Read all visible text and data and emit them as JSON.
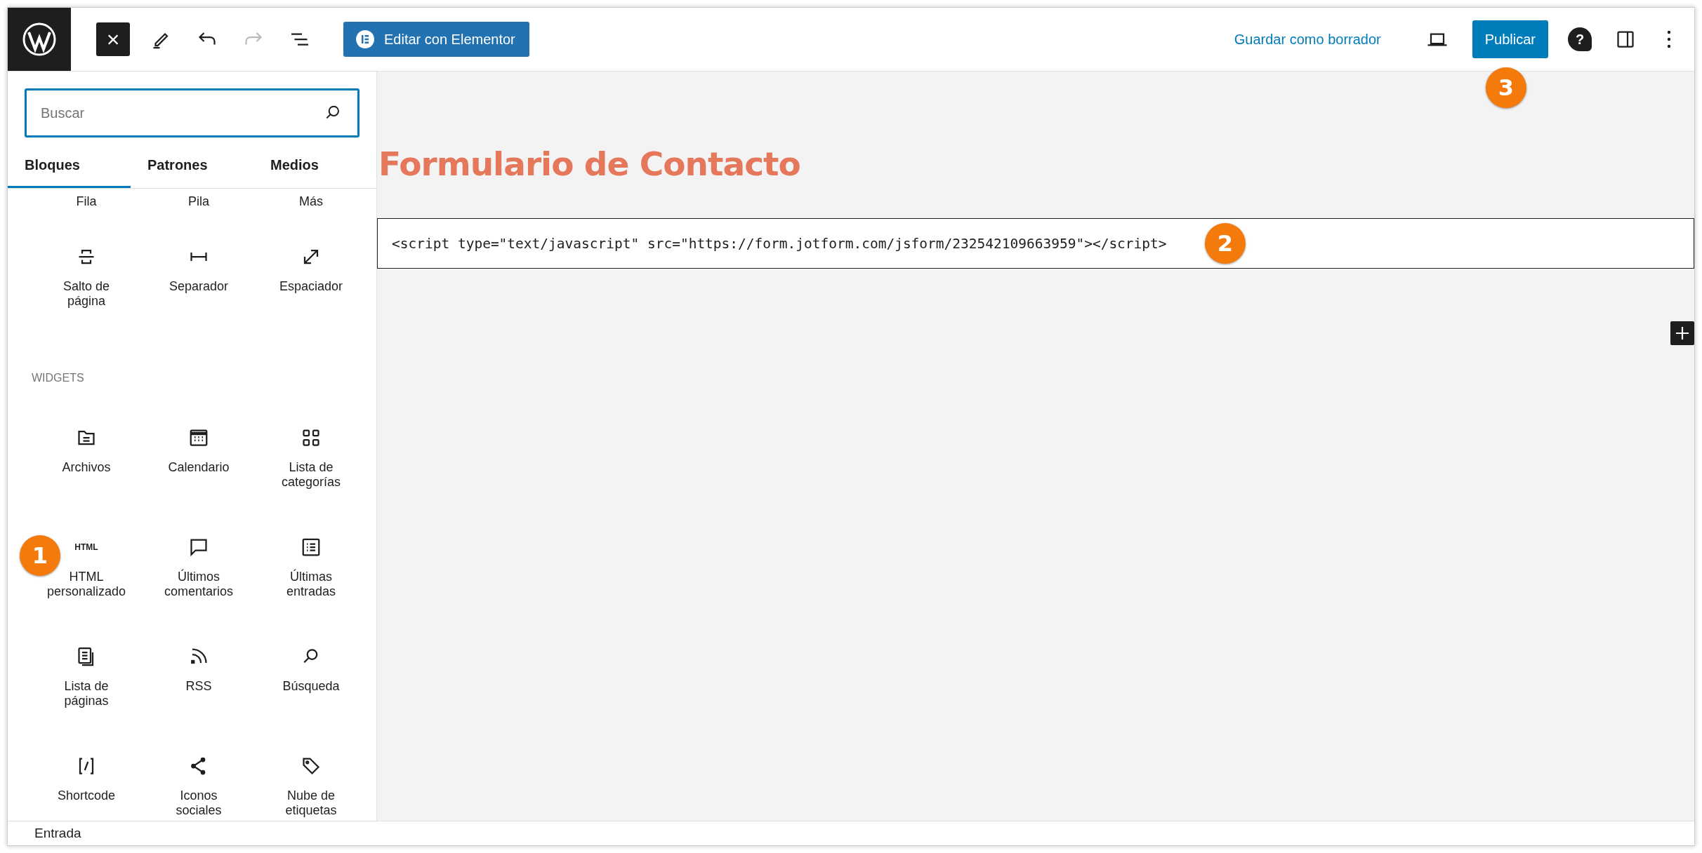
{
  "toolbar": {
    "close_glyph": "×",
    "undo": {
      "disabled": false
    },
    "redo": {
      "disabled": true
    },
    "elementor_button": "Editar con Elementor",
    "save_draft": "Guardar como borrador",
    "publish": "Publicar",
    "help_glyph": "?"
  },
  "inserter": {
    "search": {
      "placeholder": "Buscar"
    },
    "tabs": [
      {
        "label": "Bloques",
        "selected": true
      },
      {
        "label": "Patrones",
        "selected": false
      },
      {
        "label": "Medios",
        "selected": false
      }
    ],
    "scrolled_labels": [
      "Fila",
      "Pila",
      "Más"
    ],
    "design_blocks": [
      {
        "label": "Salto de página"
      },
      {
        "label": "Separador"
      },
      {
        "label": "Espaciador"
      }
    ],
    "widgets": {
      "heading": "WIDGETS",
      "items": [
        {
          "label": "Archivos"
        },
        {
          "label": "Calendario"
        },
        {
          "label": "Lista de categorías"
        },
        {
          "label": "HTML personalizado",
          "icon_text": "HTML"
        },
        {
          "label": "Últimos comentarios"
        },
        {
          "label": "Últimas entradas"
        },
        {
          "label": "Lista de páginas"
        },
        {
          "label": "RSS"
        },
        {
          "label": "Búsqueda"
        },
        {
          "label": "Shortcode"
        },
        {
          "label": "Iconos sociales"
        },
        {
          "label": "Nube de etiquetas"
        }
      ]
    }
  },
  "editor": {
    "title": "Formulario de Contacto",
    "html_block": "<script type=\"text/javascript\" src=\"https://form.jotform.com/jsform/232542109663959\"></script>"
  },
  "annotations": [
    "1",
    "2",
    "3"
  ],
  "status_bar": {
    "breadcrumb": "Entrada"
  }
}
